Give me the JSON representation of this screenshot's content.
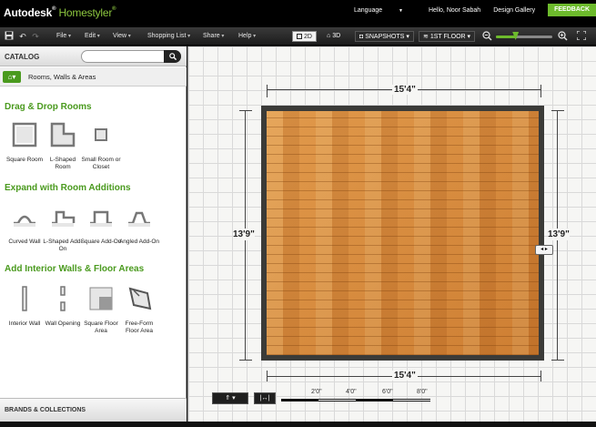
{
  "app": {
    "brand": "Autodesk",
    "reg": "®",
    "product": "Homestyler",
    "product_mark": "®"
  },
  "toplinks": {
    "language": "Language",
    "language_arrow": "▼",
    "user": "Hello, Noor Sabah",
    "gallery": "Design Gallery",
    "feedback": "FEEDBACK"
  },
  "toolbar": {
    "menus": [
      "File",
      "Edit",
      "View",
      "Shopping List",
      "Share",
      "Help"
    ],
    "view2d": "2D",
    "view3d": "3D",
    "snapshots": "SNAPSHOTS",
    "floor": "1ST FLOOR",
    "zoom_level": 0.35
  },
  "catalog": {
    "label": "CATALOG",
    "search_placeholder": "",
    "breadcrumb": "Rooms, Walls & Areas",
    "sections": [
      {
        "title": "Drag & Drop Rooms",
        "items": [
          {
            "label": "Square Room",
            "icon": "square-room-icon"
          },
          {
            "label": "L-Shaped Room",
            "icon": "l-shaped-room-icon"
          },
          {
            "label": "Small Room or Closet",
            "icon": "small-room-icon"
          }
        ]
      },
      {
        "title": "Expand with Room Additions",
        "items": [
          {
            "label": "Curved Wall",
            "icon": "curved-wall-icon"
          },
          {
            "label": "L-Shaped Add-On",
            "icon": "l-shaped-addon-icon"
          },
          {
            "label": "Square Add-On",
            "icon": "square-addon-icon"
          },
          {
            "label": "Angled Add-On",
            "icon": "angled-addon-icon"
          }
        ]
      },
      {
        "title": "Add Interior Walls & Floor Areas",
        "items": [
          {
            "label": "Interior Wall",
            "icon": "interior-wall-icon"
          },
          {
            "label": "Wall Opening",
            "icon": "wall-opening-icon"
          },
          {
            "label": "Square Floor Area",
            "icon": "square-floor-area-icon"
          },
          {
            "label": "Free-Form Floor Area",
            "icon": "freeform-floor-area-icon"
          }
        ]
      }
    ],
    "brands": "BRANDS & COLLECTIONS"
  },
  "room": {
    "width_label": "15'4\"",
    "height_label": "13'9\"",
    "scale_labels": [
      "2'0\"",
      "4'0\"",
      "6'0\"",
      "8'0\""
    ]
  },
  "colors": {
    "accent": "#6dbb2c",
    "section": "#4a9a1e",
    "wall": "#3b3b38",
    "floor": "#d98e3e"
  }
}
